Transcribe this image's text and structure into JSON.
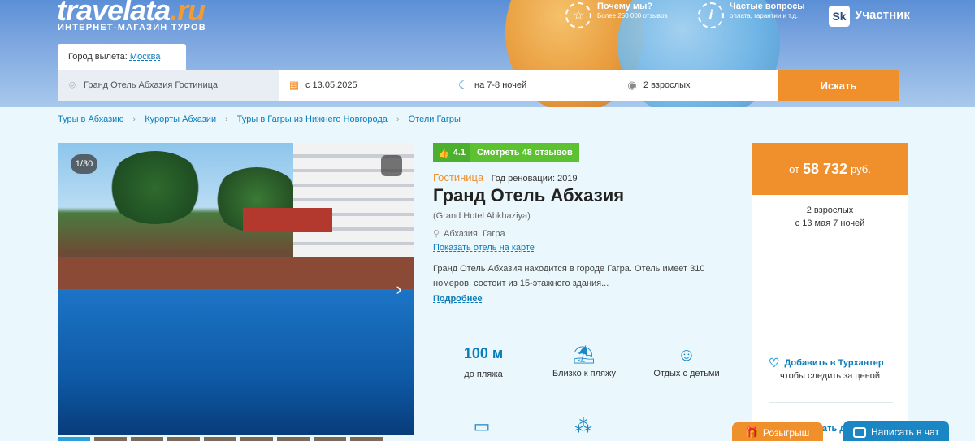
{
  "brand": {
    "logo_main": "travelata",
    "logo_ru": ".ru",
    "tagline": "ИНТЕРНЕТ-МАГАЗИН ТУРОВ"
  },
  "header": {
    "why_us": {
      "title": "Почему мы?",
      "subtitle": "Более 250 000 отзывов"
    },
    "faq": {
      "title": "Частые вопросы",
      "subtitle": "оплата, гарантии и т.д."
    },
    "member": {
      "badge": "Sk",
      "label": "Участник"
    }
  },
  "departure": {
    "label": "Город вылета:",
    "city": "Москва"
  },
  "search": {
    "destination": "Гранд Отель Абхазия Гостиница",
    "date": "с 13.05.2025",
    "nights": "на 7-8 ночей",
    "guests": "2 взрослых",
    "button": "Искать"
  },
  "breadcrumbs": [
    "Туры в Абхазию",
    "Курорты Абхазии",
    "Туры в Гагры из Нижнего Новгорода",
    "Отели Гагры"
  ],
  "gallery": {
    "counter": "1/30"
  },
  "hotel": {
    "rating": "4.1",
    "reviews_link": "Смотреть 48 отзывов",
    "type": "Гостиница",
    "renovation": "Год реновации: 2019",
    "name": "Гранд Отель Абхазия",
    "name_en": "(Grand Hotel Abkhaziya)",
    "location": "Абхазия, Гагра",
    "map_link": "Показать отель на карте",
    "description": "Гранд Отель Абхазия находится в городе Гагра. Отель имеет 310 номеров, состоит из 15-этажного здания...",
    "more_link": "Подробнее"
  },
  "features": [
    {
      "value": "100 м",
      "label": "до пляжа"
    },
    {
      "icon": "beach-icon",
      "label": "Близко к пляжу"
    },
    {
      "icon": "baby-icon",
      "label": "Отдых с детьми"
    }
  ],
  "price": {
    "prefix": "от",
    "amount": "58 732",
    "currency": "руб.",
    "guests": "2 взрослых",
    "dates": "с 13 мая 7 ночей"
  },
  "tourhunter": {
    "link": "Добавить в Турхантер",
    "note": "чтобы следить за ценой"
  },
  "widgets": {
    "draw": "Розыгрыш",
    "chat": "Написать в чат",
    "friend_partial": "ать др"
  },
  "colors": {
    "accent_orange": "#f0902c",
    "link_blue": "#0b7cba",
    "rating_green": "#5cc232"
  }
}
